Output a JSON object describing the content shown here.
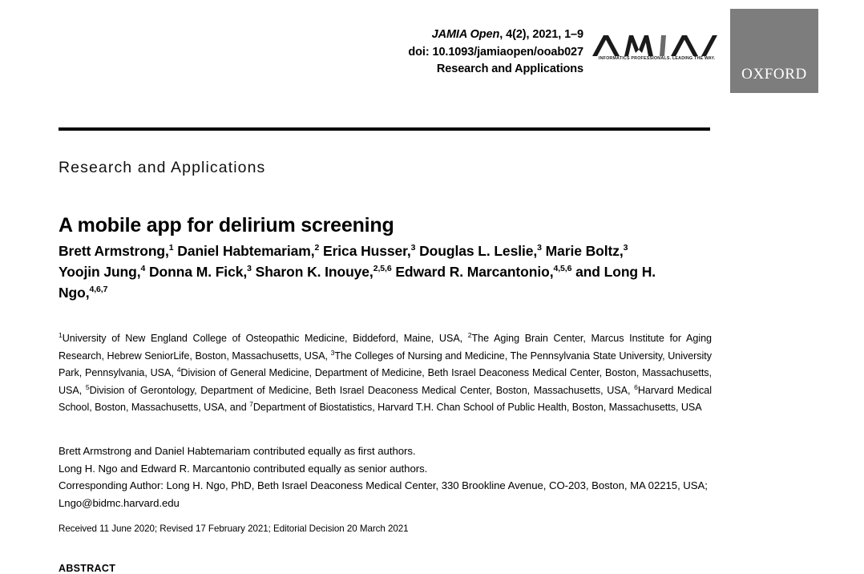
{
  "masthead": {
    "journal_name": "JAMIA Open",
    "citation_rest": ", 4(2), 2021, 1–9",
    "doi": "doi: 10.1093/jamiaopen/ooab027",
    "section": "Research and Applications",
    "amia_logo_text": "AMIA",
    "amia_tagline": "INFORMATICS PROFESSIONALS. LEADING THE WAY.",
    "publisher": "OXFORD",
    "publisher_box_color": "#7d7d7d"
  },
  "article": {
    "section_label": "Research and Applications",
    "title": "A mobile app for delirium screening",
    "authors_html": "Brett Armstrong,<sup>1</sup> Daniel Habtemariam,<sup>2</sup> Erica Husser,<sup>3</sup> Douglas L. Leslie,<sup>3</sup> Marie Boltz,<sup>3</sup> Yoojin Jung,<sup>4</sup> Donna M. Fick,<sup>3</sup> Sharon K. Inouye,<sup>2,5,6</sup> Edward R. Marcantonio,<sup>4,5,6</sup> and Long H. Ngo,<sup>4,6,7</sup>",
    "affiliations_html": "<sup>1</sup>University of New England College of Osteopathic Medicine, Biddeford, Maine, USA, <sup>2</sup>The Aging Brain Center, Marcus Institute for Aging Research, Hebrew SeniorLife, Boston, Massachusetts, USA, <sup>3</sup>The Colleges of Nursing and Medicine, The Pennsylvania State University, University Park, Pennsylvania, USA, <sup>4</sup>Division of General Medicine, Department of Medicine, Beth Israel Deaconess Medical Center, Boston, Massachusetts, USA, <sup>5</sup>Division of Gerontology, Department of Medicine, Beth Israel Deaconess Medical Center, Boston, Massachusetts, USA, <sup>6</sup>Harvard Medical School, Boston, Massachusetts, USA, and <sup>7</sup>Department of Biostatistics, Harvard T.H. Chan School of Public Health, Boston, Massachusetts, USA",
    "note_first_authors": "Brett Armstrong and Daniel Habtemariam contributed equally as first authors.",
    "note_senior_authors": "Long H. Ngo and Edward R. Marcantonio contributed equally as senior authors.",
    "corresponding_author": "Corresponding Author: Long H. Ngo, PhD, Beth Israel Deaconess Medical Center, 330 Brookline Avenue, CO-203, Boston, MA 02215, USA; Lngo@bidmc.harvard.edu",
    "history": "Received 11 June 2020; Revised 17 February 2021; Editorial Decision 20 March 2021",
    "abstract_heading": "ABSTRACT"
  }
}
